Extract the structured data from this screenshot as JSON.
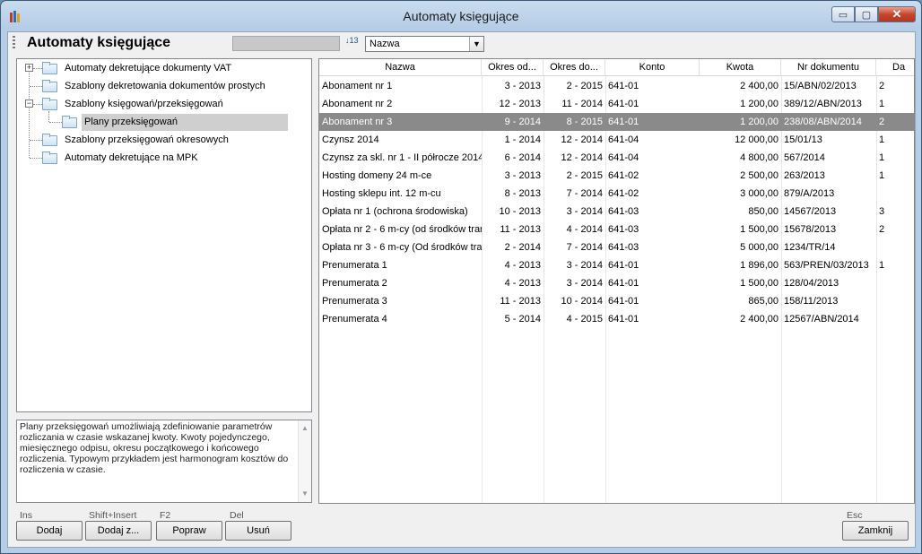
{
  "window": {
    "title": "Automaty księgujące",
    "minimize": "▭",
    "maximize": "▢",
    "close": "✕"
  },
  "toolbar": {
    "title": "Automaty księgujące",
    "sort_value": "Nazwa",
    "sort_icon_text": "↓13"
  },
  "tree": {
    "items": [
      {
        "label": "Automaty dekretujące dokumenty VAT"
      },
      {
        "label": "Szablony dekretowania dokumentów prostych"
      },
      {
        "label": "Szablony księgowań/przeksięgowań"
      },
      {
        "label": "Plany przeksięgowań"
      },
      {
        "label": "Szablony przeksięgowań okresowych"
      },
      {
        "label": "Automaty dekretujące na MPK"
      }
    ],
    "expand_symbol": "+",
    "collapse_symbol": "−"
  },
  "description": "Plany przeksięgowań umożliwiają zdefiniowanie parametrów rozliczania w czasie wskazanej kwoty. Kwoty pojedynczego, miesięcznego odpisu, okresu początkowego i końcowego rozliczenia. Typowym przykładem jest harmonogram kosztów do rozliczenia w czasie.",
  "grid": {
    "columns": [
      "Nazwa",
      "Okres od...",
      "Okres do...",
      "Konto",
      "Kwota",
      "Nr dokumentu",
      "Da"
    ],
    "rows": [
      {
        "nazwa": "Abonament nr 1",
        "od": "3 - 2013",
        "do": "2 - 2015",
        "konto": "641-01",
        "kwota": "2 400,00",
        "nr": "15/ABN/02/2013",
        "da": "2"
      },
      {
        "nazwa": "Abonament nr 2",
        "od": "12 - 2013",
        "do": "11 - 2014",
        "konto": "641-01",
        "kwota": "1 200,00",
        "nr": "389/12/ABN/2013",
        "da": "1"
      },
      {
        "nazwa": "Abonament nr 3",
        "od": "9 - 2014",
        "do": "8 - 2015",
        "konto": "641-01",
        "kwota": "1 200,00",
        "nr": "238/08/ABN/2014",
        "da": "2"
      },
      {
        "nazwa": "Czynsz 2014",
        "od": "1 - 2014",
        "do": "12 - 2014",
        "konto": "641-04",
        "kwota": "12 000,00",
        "nr": "15/01/13",
        "da": "1"
      },
      {
        "nazwa": "Czynsz za skl. nr 1 - II półrocze 2014",
        "od": "6 - 2014",
        "do": "12 - 2014",
        "konto": "641-04",
        "kwota": "4 800,00",
        "nr": "567/2014",
        "da": "1"
      },
      {
        "nazwa": "Hosting domeny 24 m-ce",
        "od": "3 - 2013",
        "do": "2 - 2015",
        "konto": "641-02",
        "kwota": "2 500,00",
        "nr": "263/2013",
        "da": "1"
      },
      {
        "nazwa": "Hosting sklepu int. 12 m-cu",
        "od": "8 - 2013",
        "do": "7 - 2014",
        "konto": "641-02",
        "kwota": "3 000,00",
        "nr": "879/A/2013",
        "da": ""
      },
      {
        "nazwa": "Opłata nr 1 (ochrona środowiska)",
        "od": "10 - 2013",
        "do": "3 - 2014",
        "konto": "641-03",
        "kwota": "850,00",
        "nr": "14567/2013",
        "da": "3"
      },
      {
        "nazwa": "Opłata nr 2 - 6 m-cy (od środków tran",
        "od": "11 - 2013",
        "do": "4 - 2014",
        "konto": "641-03",
        "kwota": "1 500,00",
        "nr": "15678/2013",
        "da": "2"
      },
      {
        "nazwa": "Opłata nr 3 - 6 m-cy (Od środków tran",
        "od": "2 - 2014",
        "do": "7 - 2014",
        "konto": "641-03",
        "kwota": "5 000,00",
        "nr": "1234/TR/14",
        "da": ""
      },
      {
        "nazwa": "Prenumerata 1",
        "od": "4 - 2013",
        "do": "3 - 2014",
        "konto": "641-01",
        "kwota": "1 896,00",
        "nr": "563/PREN/03/2013",
        "da": "1"
      },
      {
        "nazwa": "Prenumerata 2",
        "od": "4 - 2013",
        "do": "3 - 2014",
        "konto": "641-01",
        "kwota": "1 500,00",
        "nr": "128/04/2013",
        "da": ""
      },
      {
        "nazwa": "Prenumerata 3",
        "od": "11 - 2013",
        "do": "10 - 2014",
        "konto": "641-01",
        "kwota": "865,00",
        "nr": "158/11/2013",
        "da": ""
      },
      {
        "nazwa": "Prenumerata 4",
        "od": "5 - 2014",
        "do": "4 - 2015",
        "konto": "641-01",
        "kwota": "2 400,00",
        "nr": "12567/ABN/2014",
        "da": ""
      }
    ]
  },
  "buttons": {
    "add": {
      "label": "Dodaj",
      "key": "Ins"
    },
    "add_copy": {
      "label": "Dodaj z...",
      "key": "Shift+Insert"
    },
    "edit": {
      "label": "Popraw",
      "key": "F2"
    },
    "delete": {
      "label": "Usuń",
      "key": "Del"
    },
    "close": {
      "label": "Zamknij",
      "key": "Esc"
    }
  }
}
